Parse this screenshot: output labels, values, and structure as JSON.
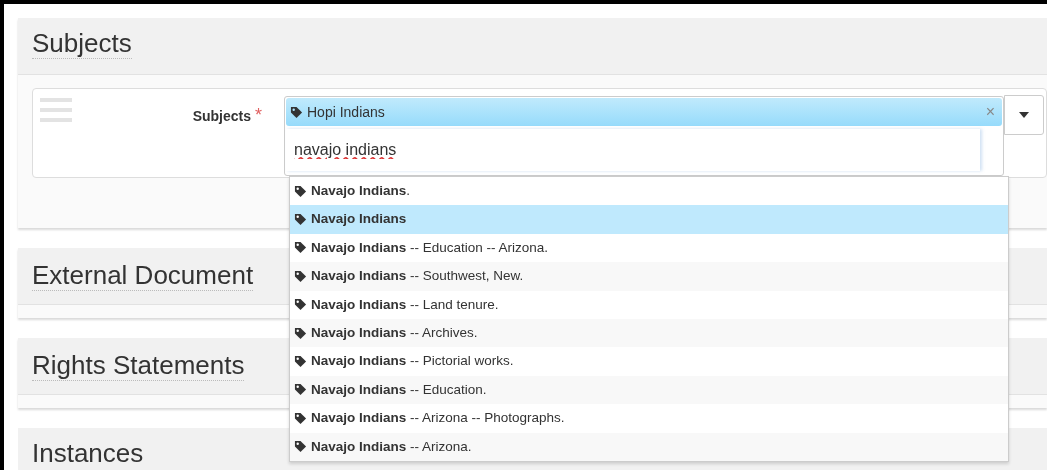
{
  "sections": [
    {
      "title": "Subjects"
    },
    {
      "title": "External Document"
    },
    {
      "title": "Rights Statements"
    },
    {
      "title": "Instances"
    }
  ],
  "subjects_field": {
    "label": "Subjects",
    "required_mark": "*",
    "token": "Hopi Indians",
    "remove": "×",
    "search_value": "navajo indians"
  },
  "suggestions": [
    {
      "text": "**Navajo Indians**.",
      "selected": false
    },
    {
      "text": "**Navajo Indians**",
      "selected": true
    },
    {
      "text": "**Navajo Indians** -- Education -- Arizona.",
      "selected": false
    },
    {
      "text": "**Navajo Indians** -- Southwest, New.",
      "selected": false
    },
    {
      "text": "**Navajo Indians** -- Land tenure.",
      "selected": false
    },
    {
      "text": "**Navajo Indians** -- Archives.",
      "selected": false
    },
    {
      "text": "**Navajo Indians** -- Pictorial works.",
      "selected": false
    },
    {
      "text": "**Navajo Indians** -- Education.",
      "selected": false
    },
    {
      "text": "**Navajo Indians** -- Arizona -- Photographs.",
      "selected": false
    },
    {
      "text": "**Navajo Indians** -- Arizona.",
      "selected": false
    }
  ]
}
